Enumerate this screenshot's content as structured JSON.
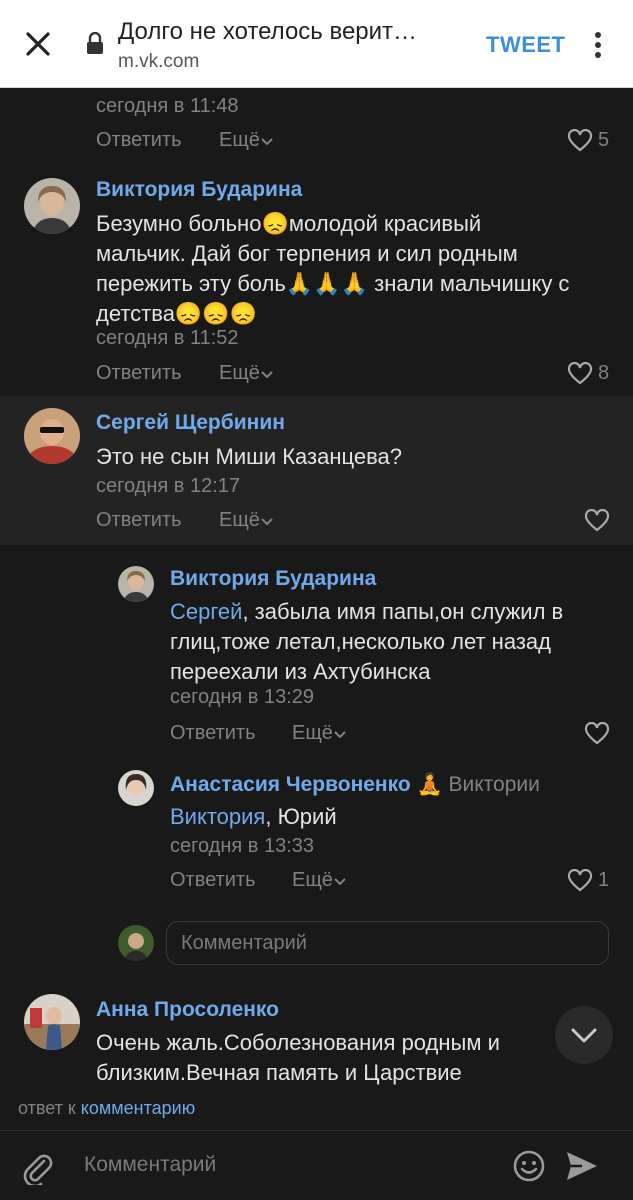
{
  "topbar": {
    "title": "Долго не хотелось верит…",
    "url": "m.vk.com",
    "tweet_label": "TWEET"
  },
  "comments": [
    {
      "time": "сегодня в 11:48",
      "reply_label": "Ответить",
      "more_label": "Ещё",
      "likes": "5"
    },
    {
      "author": "Виктория Бударина",
      "lines": [
        "Безумно больно😞молодой красивый",
        "мальчик. Дай бог терпения и сил родным",
        "пережить эту боль🙏🙏🙏 знали мальчишку с",
        "детства😞😞😞"
      ],
      "time": "сегодня в 11:52",
      "reply_label": "Ответить",
      "more_label": "Ещё",
      "likes": "8"
    },
    {
      "author": "Сергей Щербинин",
      "lines": [
        "Это не сын Миши Казанцева?"
      ],
      "time": "сегодня в 12:17",
      "reply_label": "Ответить",
      "more_label": "Ещё",
      "likes": ""
    },
    {
      "author": "Виктория Бударина",
      "mention": "Сергей",
      "lines": [
        ", забыла имя папы,он служил в",
        "глиц,тоже летал,несколько лет назад",
        "переехали из Ахтубинска"
      ],
      "time": "сегодня в 13:29",
      "reply_label": "Ответить",
      "more_label": "Ещё",
      "likes": ""
    },
    {
      "author": "Анастасия Червоненко 🧘",
      "reply_to": "Виктории",
      "mention": "Виктория",
      "lines": [
        ", Юрий"
      ],
      "time": "сегодня в 13:33",
      "reply_label": "Ответить",
      "more_label": "Ещё",
      "likes": "1"
    },
    {
      "author": "Анна Просоленко",
      "lines": [
        "Очень жаль.Соболезнования родным и",
        "близким.Вечная память и Царствие"
      ]
    }
  ],
  "thread_input": {
    "placeholder": "Комментарий"
  },
  "reply_bar": {
    "prefix": "ответ к",
    "link": "комментарию"
  },
  "composer": {
    "placeholder": "Комментарий"
  },
  "colors": {
    "background": "#191919",
    "link": "#71aaeb",
    "muted": "#828282",
    "text": "#e1e3e6"
  }
}
